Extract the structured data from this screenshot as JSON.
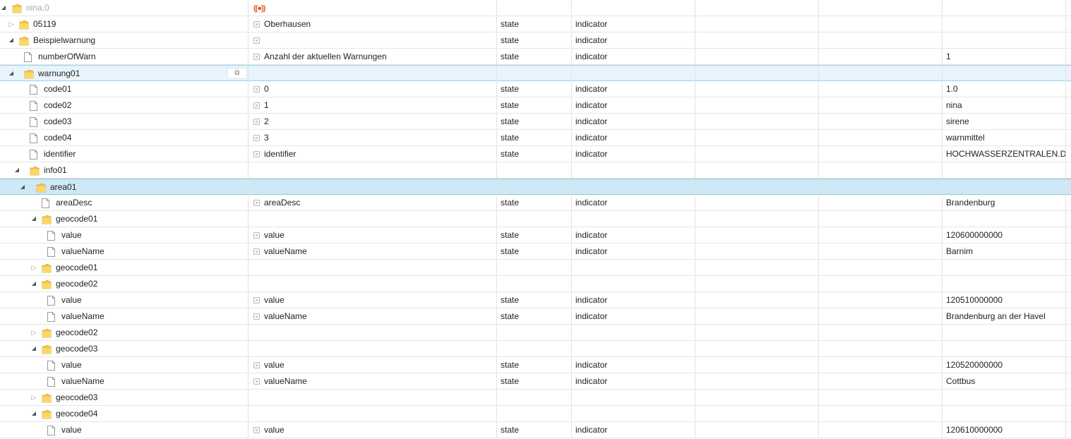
{
  "rows": [
    {
      "id": "nina.0",
      "depth": 0,
      "kind": "folder",
      "toggle": "expanded",
      "dim": true,
      "name": "",
      "has_name_icon": false,
      "type": "",
      "role": "",
      "value": "",
      "special": "siren"
    },
    {
      "id": "05119",
      "depth": 1,
      "kind": "folder",
      "toggle": "collapsed",
      "name": "Oberhausen",
      "has_name_icon": true,
      "type": "state",
      "role": "indicator",
      "value": ""
    },
    {
      "id": "Beispielwarnung",
      "depth": 1,
      "kind": "folder",
      "toggle": "expanded",
      "name": "",
      "has_name_icon": true,
      "type": "state",
      "role": "indicator",
      "value": ""
    },
    {
      "id": "numberOfWarn",
      "depth": 2,
      "kind": "file",
      "name": "Anzahl der aktuellen Warnungen",
      "has_name_icon": true,
      "type": "state",
      "role": "indicator",
      "value": "1"
    },
    {
      "id": "warnung01",
      "depth": 2,
      "kind": "folder",
      "toggle": "expanded",
      "name": "",
      "has_name_icon": false,
      "type": "",
      "role": "",
      "value": "",
      "selected": "light",
      "copy": true
    },
    {
      "id": "code01",
      "depth": 3,
      "kind": "file",
      "name": "0",
      "has_name_icon": true,
      "type": "state",
      "role": "indicator",
      "value": "1.0"
    },
    {
      "id": "code02",
      "depth": 3,
      "kind": "file",
      "name": "1",
      "has_name_icon": true,
      "type": "state",
      "role": "indicator",
      "value": "nina"
    },
    {
      "id": "code03",
      "depth": 3,
      "kind": "file",
      "name": "2",
      "has_name_icon": true,
      "type": "state",
      "role": "indicator",
      "value": "sirene"
    },
    {
      "id": "code04",
      "depth": 3,
      "kind": "file",
      "name": "3",
      "has_name_icon": true,
      "type": "state",
      "role": "indicator",
      "value": "warnmittel"
    },
    {
      "id": "identifier",
      "depth": 3,
      "kind": "file",
      "name": "identifier",
      "has_name_icon": true,
      "type": "state",
      "role": "indicator",
      "value": "HOCHWASSERZENTRALEN.DE.BE"
    },
    {
      "id": "info01",
      "depth": 3,
      "kind": "folder",
      "toggle": "expanded",
      "name": "",
      "has_name_icon": false,
      "type": "",
      "role": "",
      "value": ""
    },
    {
      "id": "area01",
      "depth": 4,
      "kind": "folder",
      "toggle": "expanded",
      "name": "",
      "has_name_icon": false,
      "type": "",
      "role": "",
      "value": "",
      "selected": "strong"
    },
    {
      "id": "areaDesc",
      "depth": 5,
      "kind": "file",
      "name": "areaDesc",
      "has_name_icon": true,
      "type": "state",
      "role": "indicator",
      "value": "Brandenburg"
    },
    {
      "id": "geocode01",
      "depth": 5,
      "kind": "folder",
      "toggle": "expanded",
      "name": "",
      "has_name_icon": false,
      "type": "",
      "role": "",
      "value": ""
    },
    {
      "id": "value",
      "depth": 6,
      "kind": "file",
      "name": "value",
      "has_name_icon": true,
      "type": "state",
      "role": "indicator",
      "value": "120600000000"
    },
    {
      "id": "valueName",
      "depth": 6,
      "kind": "file",
      "name": "valueName",
      "has_name_icon": true,
      "type": "state",
      "role": "indicator",
      "value": "Barnim"
    },
    {
      "id": "geocode01",
      "depth": 5,
      "kind": "folder",
      "toggle": "collapsed",
      "name": "",
      "has_name_icon": false,
      "type": "",
      "role": "",
      "value": ""
    },
    {
      "id": "geocode02",
      "depth": 5,
      "kind": "folder",
      "toggle": "expanded",
      "name": "",
      "has_name_icon": false,
      "type": "",
      "role": "",
      "value": ""
    },
    {
      "id": "value",
      "depth": 6,
      "kind": "file",
      "name": "value",
      "has_name_icon": true,
      "type": "state",
      "role": "indicator",
      "value": "120510000000"
    },
    {
      "id": "valueName",
      "depth": 6,
      "kind": "file",
      "name": "valueName",
      "has_name_icon": true,
      "type": "state",
      "role": "indicator",
      "value": "Brandenburg an der Havel"
    },
    {
      "id": "geocode02",
      "depth": 5,
      "kind": "folder",
      "toggle": "collapsed",
      "name": "",
      "has_name_icon": false,
      "type": "",
      "role": "",
      "value": ""
    },
    {
      "id": "geocode03",
      "depth": 5,
      "kind": "folder",
      "toggle": "expanded",
      "name": "",
      "has_name_icon": false,
      "type": "",
      "role": "",
      "value": ""
    },
    {
      "id": "value",
      "depth": 6,
      "kind": "file",
      "name": "value",
      "has_name_icon": true,
      "type": "state",
      "role": "indicator",
      "value": "120520000000"
    },
    {
      "id": "valueName",
      "depth": 6,
      "kind": "file",
      "name": "valueName",
      "has_name_icon": true,
      "type": "state",
      "role": "indicator",
      "value": "Cottbus"
    },
    {
      "id": "geocode03",
      "depth": 5,
      "kind": "folder",
      "toggle": "collapsed",
      "name": "",
      "has_name_icon": false,
      "type": "",
      "role": "",
      "value": ""
    },
    {
      "id": "geocode04",
      "depth": 5,
      "kind": "folder",
      "toggle": "expanded",
      "name": "",
      "has_name_icon": false,
      "type": "",
      "role": "",
      "value": ""
    },
    {
      "id": "value",
      "depth": 6,
      "kind": "file",
      "name": "value",
      "has_name_icon": true,
      "type": "state",
      "role": "indicator",
      "value": "120610000000"
    }
  ],
  "icons": {
    "expanded": "triangle-down-icon",
    "collapsed": "triangle-right-icon",
    "folder": "folder-icon",
    "file": "file-icon",
    "copy": "copy-icon",
    "siren": "siren-icon"
  },
  "colors": {
    "folder": "#f3c64b",
    "selected_light": "#e8f4fb",
    "selected_strong": "#cfe8f6",
    "siren": "#e0552c"
  }
}
